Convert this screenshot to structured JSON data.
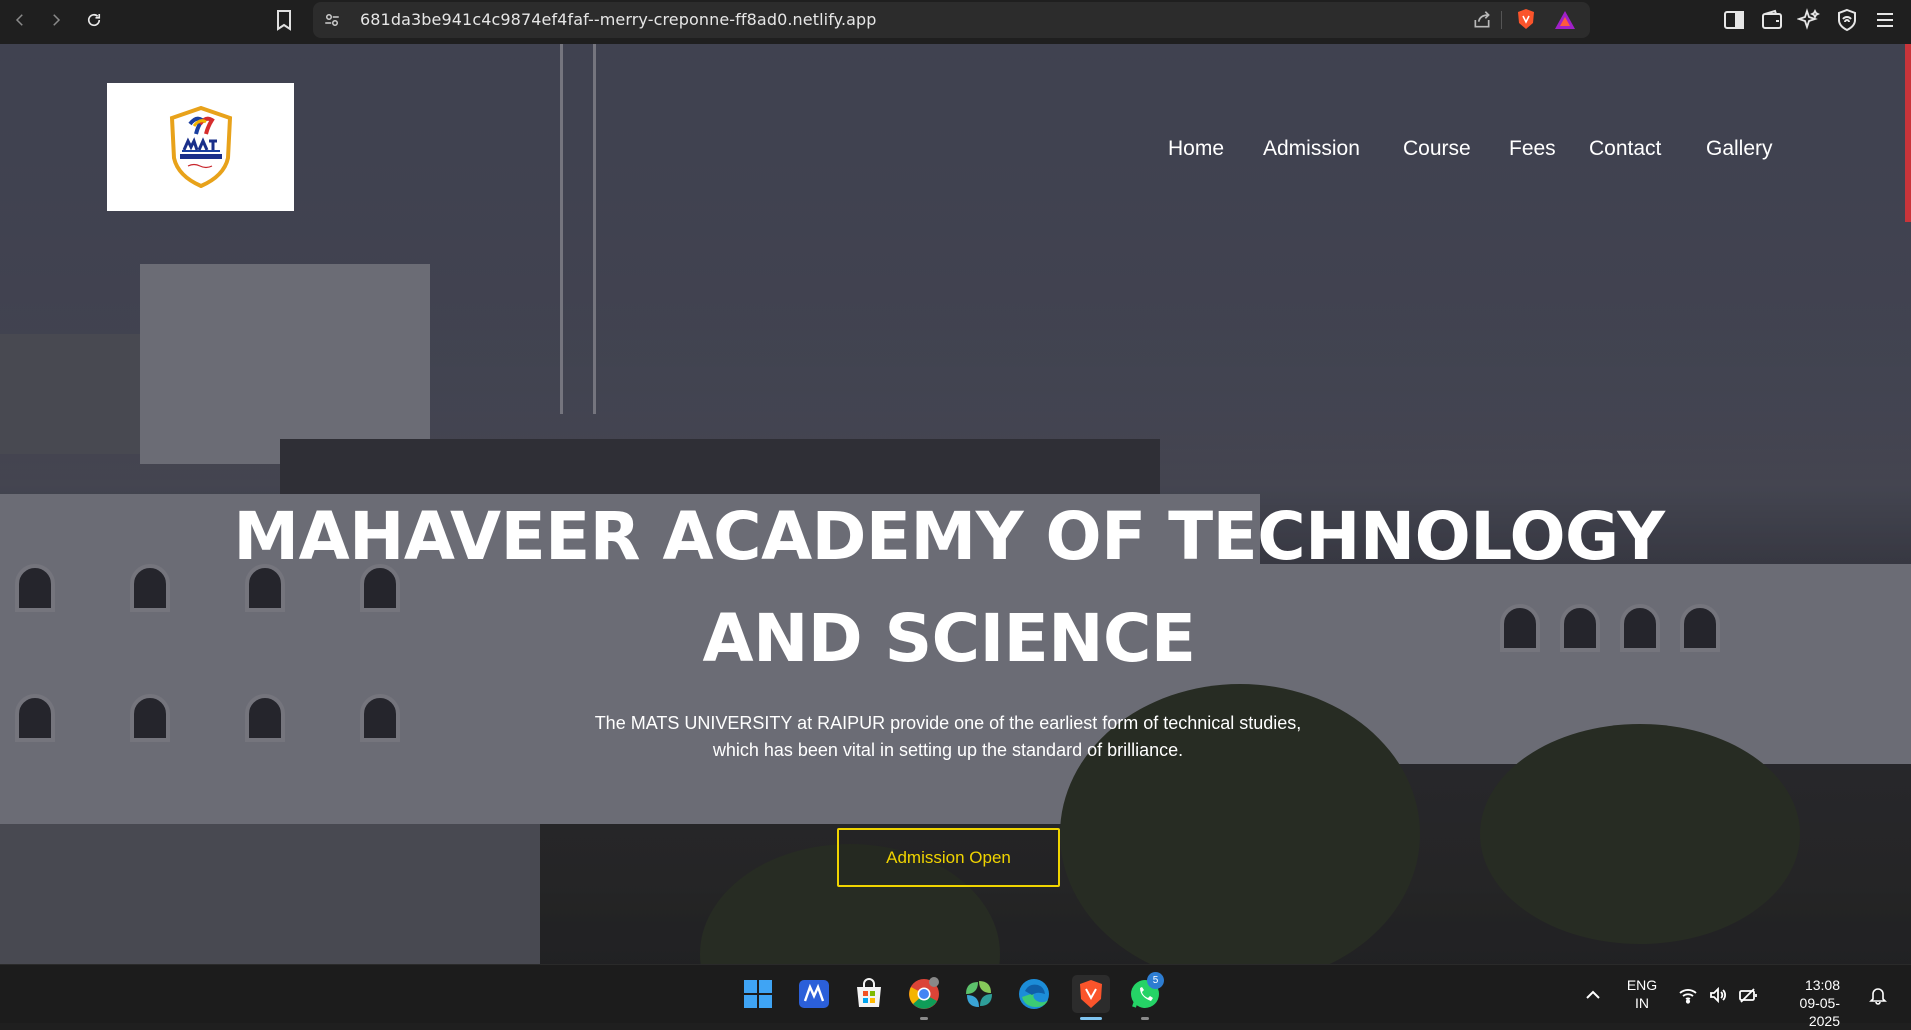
{
  "browser": {
    "url": "681da3be941c4c9874ef4faf--merry-creponne-ff8ad0.netlify.app",
    "icons": [
      "back-icon",
      "forward-icon",
      "reload-icon",
      "bookmark-icon",
      "site-settings-icon",
      "share-icon",
      "brave-shield-icon",
      "brave-rewards-icon",
      "sidebar-icon",
      "wallet-icon",
      "leo-ai-icon",
      "vpn-icon",
      "menu-icon"
    ]
  },
  "site": {
    "logo_alt": "MATS University",
    "nav": [
      {
        "label": "Home"
      },
      {
        "label": "Admission"
      },
      {
        "label": "Course"
      },
      {
        "label": "Fees"
      },
      {
        "label": "Contact"
      },
      {
        "label": "Gallery"
      }
    ],
    "headline": "MAHAVEER ACADEMY OF TECHNOLOGY AND SCIENCE",
    "subtext_line1": "The MATS UNIVERSITY at RAIPUR provide one of the earliest form of technical studies,",
    "subtext_line2": "which has been vital in setting up the standard of brilliance.",
    "cta_label": "Admission Open",
    "accent_color": "#f0d400"
  },
  "taskbar": {
    "apps": [
      "windows-start",
      "microsoft-365",
      "microsoft-store",
      "chrome",
      "files-app",
      "edge",
      "brave",
      "whatsapp"
    ],
    "whatsapp_badge": "5",
    "language_line1": "ENG",
    "language_line2": "IN",
    "time": "13:08",
    "date": "09-05-2025"
  }
}
